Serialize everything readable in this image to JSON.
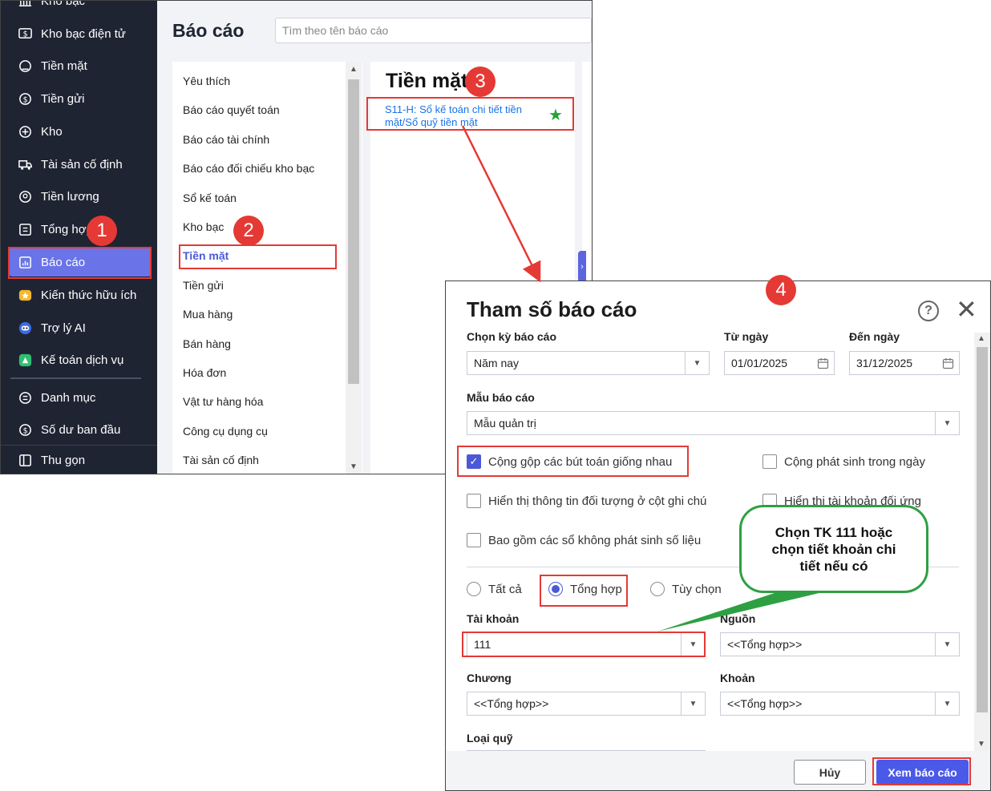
{
  "sidebar": {
    "items": [
      {
        "label": "Kho bạc",
        "icon": "bank-icon"
      },
      {
        "label": "Kho bạc điện tử",
        "icon": "e-treasury-icon"
      },
      {
        "label": "Tiền mặt",
        "icon": "cash-icon"
      },
      {
        "label": "Tiền gửi",
        "icon": "deposit-icon"
      },
      {
        "label": "Kho",
        "icon": "warehouse-icon"
      },
      {
        "label": "Tài sản cố định",
        "icon": "truck-icon"
      },
      {
        "label": "Tiền lương",
        "icon": "salary-icon"
      },
      {
        "label": "Tổng hợp",
        "icon": "summary-icon"
      },
      {
        "label": "Báo cáo",
        "icon": "report-icon"
      },
      {
        "label": "Kiến thức hữu ích",
        "icon": "knowledge-icon"
      },
      {
        "label": "Trợ lý AI",
        "icon": "ai-assistant-icon"
      },
      {
        "label": "Kế toán dịch vụ",
        "icon": "accounting-service-icon"
      },
      {
        "label": "Danh mục",
        "icon": "catalog-icon"
      },
      {
        "label": "Số dư ban đầu",
        "icon": "opening-balance-icon"
      },
      {
        "label": "Thu gọn",
        "icon": "collapse-icon"
      }
    ],
    "active_index": 8
  },
  "header": {
    "title": "Báo cáo",
    "search_placeholder": "Tìm theo tên báo cáo"
  },
  "categories": {
    "items": [
      "Yêu thích",
      "Báo cáo quyết toán",
      "Báo cáo tài chính",
      "Báo cáo đối chiếu kho bạc",
      "Sổ kế toán",
      "Kho bạc",
      "Tiền mặt",
      "Tiền gửi",
      "Mua hàng",
      "Bán hàng",
      "Hóa đơn",
      "Vật tư hàng hóa",
      "Công cụ dụng cụ",
      "Tài sản cố định"
    ],
    "selected": "Tiền mặt"
  },
  "reports": {
    "title": "Tiền mặt",
    "item_line1": "S11-H: Sổ kế toán chi tiết tiền",
    "item_line2": "mặt/Sổ quỹ tiền mặt",
    "favorite": true
  },
  "dialog": {
    "title": "Tham số báo cáo",
    "period_label": "Chọn kỳ báo cáo",
    "period_value": "Năm nay",
    "from_label": "Từ ngày",
    "from_value": "01/01/2025",
    "to_label": "Đến ngày",
    "to_value": "31/12/2025",
    "template_label": "Mẫu báo cáo",
    "template_value": "Mẫu quản trị",
    "checkboxes": {
      "merge_entries": {
        "label": "Cộng gộp các bút toán giống nhau",
        "checked": true
      },
      "daily_total": {
        "label": "Cộng phát sinh trong ngày",
        "checked": false
      },
      "show_object_info": {
        "label": "Hiển thị thông tin đối tượng ở cột ghi chú",
        "checked": false
      },
      "show_counter_account": {
        "label": "Hiển thị tài khoản đối ứng",
        "checked": false
      },
      "include_empty": {
        "label": "Bao gồm các sổ không phát sinh số liệu",
        "checked": false
      }
    },
    "radios": {
      "all": "Tất cả",
      "summary": "Tổng hợp",
      "custom": "Tùy chọn",
      "selected": "summary"
    },
    "account_label": "Tài khoản",
    "account_value": "111",
    "source_label": "Nguồn",
    "source_value": "<<Tổng hợp>>",
    "chapter_label": "Chương",
    "chapter_value": "<<Tổng hợp>>",
    "item_label": "Khoản",
    "item_value": "<<Tổng hợp>>",
    "fund_type_label": "Loại quỹ",
    "cancel_label": "Hủy",
    "view_label": "Xem báo cáo"
  },
  "annotations": {
    "steps": [
      "1",
      "2",
      "3",
      "4"
    ],
    "callout": "Chọn TK 111 hoặc chọn tiết khoản chi tiết nếu có",
    "highlight_color": "#e53935",
    "callout_color": "#2ea043"
  },
  "colors": {
    "sidebar_bg": "#1f2433",
    "accent": "#4b59d8",
    "active_nav": "#6a74e8"
  }
}
